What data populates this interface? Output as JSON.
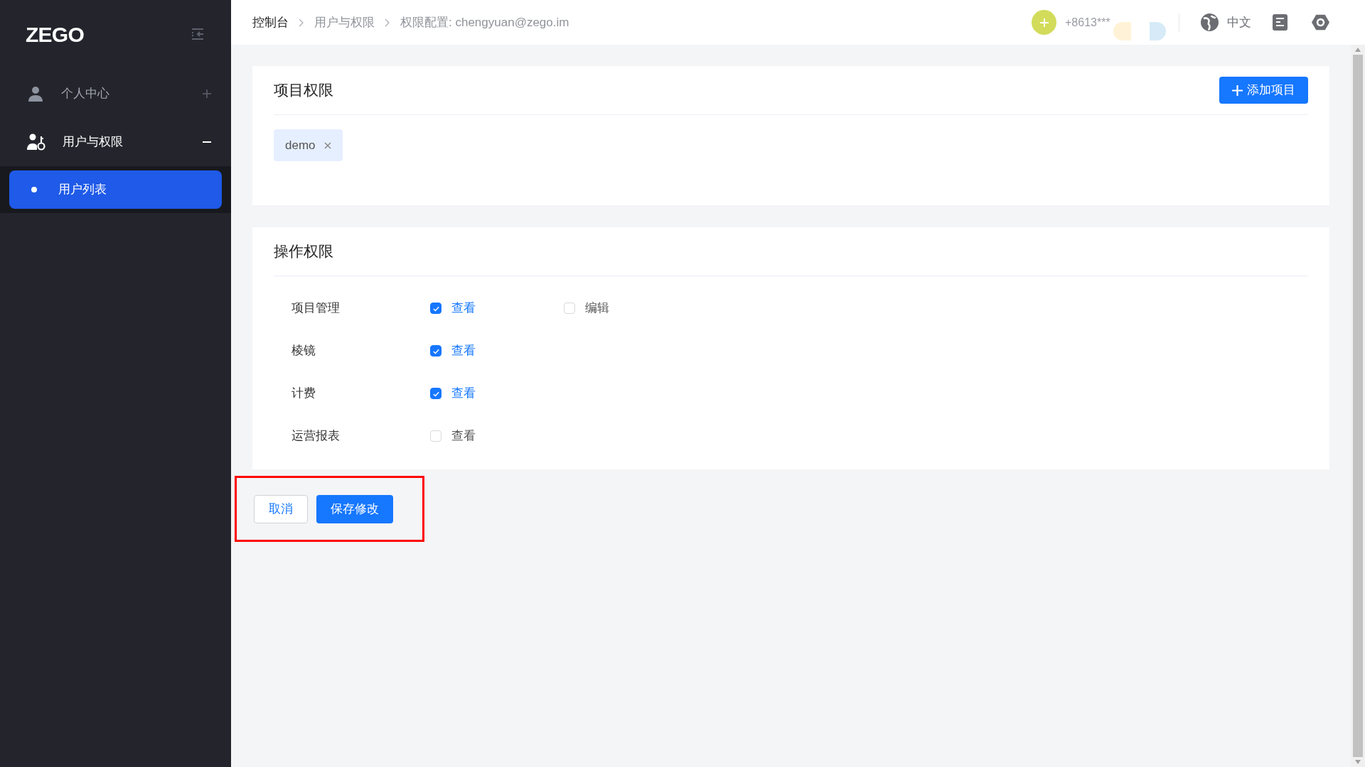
{
  "sidebar": {
    "logo": "ZEGO",
    "items": [
      {
        "label": "个人中心",
        "expanded": false
      },
      {
        "label": "用户与权限",
        "expanded": true,
        "children": [
          {
            "label": "用户列表",
            "selected": true
          }
        ]
      }
    ]
  },
  "header": {
    "breadcrumb": [
      "控制台",
      "用户与权限",
      "权限配置: chengyuan@zego.im"
    ],
    "phone": "+8613***",
    "language": "中文"
  },
  "project_permissions": {
    "title": "项目权限",
    "add_button": "添加项目",
    "tags": [
      "demo"
    ]
  },
  "operation_permissions": {
    "title": "操作权限",
    "rows": [
      {
        "label": "项目管理",
        "options": [
          {
            "label": "查看",
            "checked": true
          },
          {
            "label": "编辑",
            "checked": false
          }
        ]
      },
      {
        "label": "棱镜",
        "options": [
          {
            "label": "查看",
            "checked": true
          }
        ]
      },
      {
        "label": "计费",
        "options": [
          {
            "label": "查看",
            "checked": true
          }
        ]
      },
      {
        "label": "运营报表",
        "options": [
          {
            "label": "查看",
            "checked": false
          }
        ]
      }
    ]
  },
  "actions": {
    "cancel": "取消",
    "save": "保存修改",
    "highlighted": true
  }
}
